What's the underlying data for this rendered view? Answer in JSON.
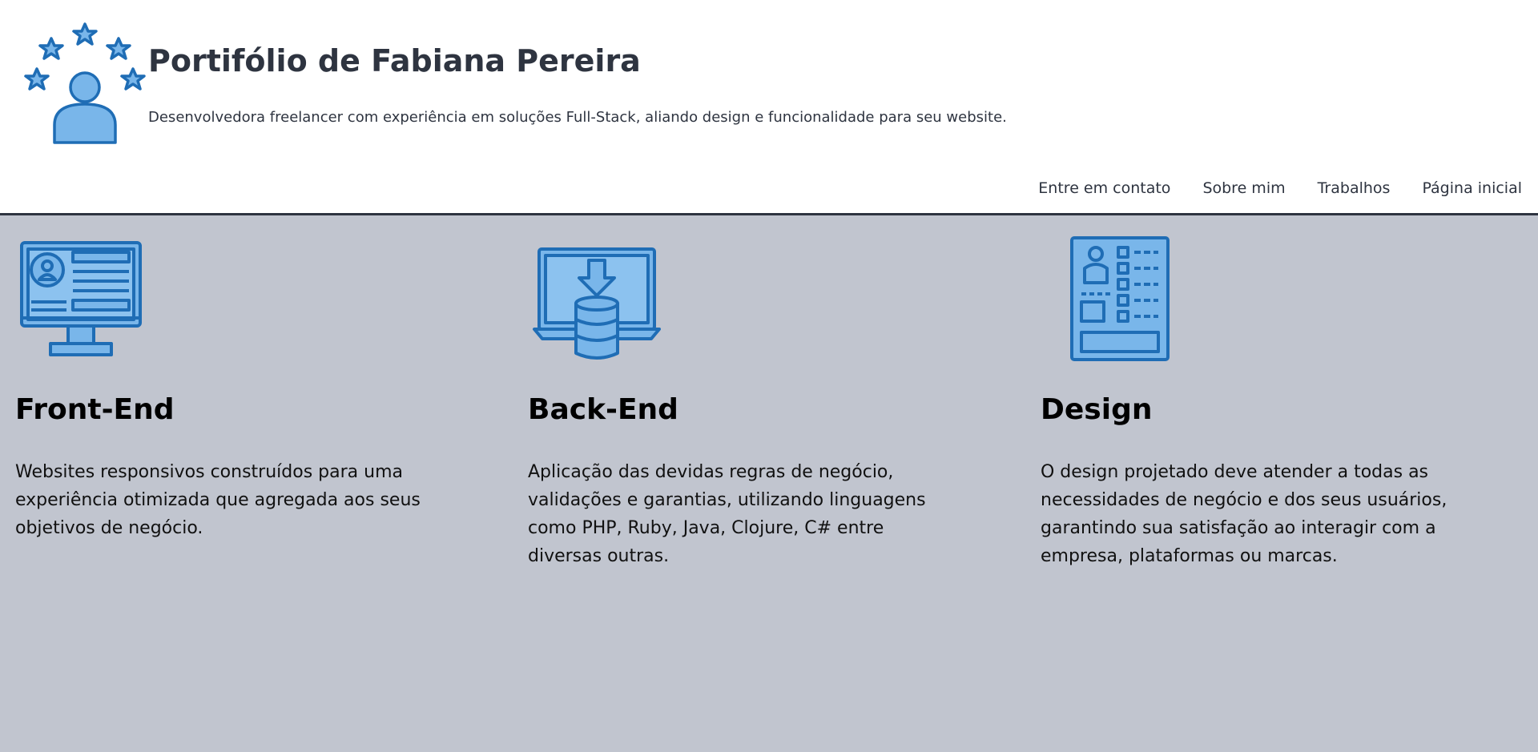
{
  "header": {
    "title": "Portifólio de Fabiana Pereira",
    "subtitle": "Desenvolvedora freelancer com experiência em soluções Full-Stack, aliando design e funcionalidade para seu website.",
    "logo_icon": "user-stars-icon"
  },
  "nav": {
    "items": [
      {
        "label": "Entre em contato"
      },
      {
        "label": "Sobre mim"
      },
      {
        "label": "Trabalhos"
      },
      {
        "label": "Página inicial"
      }
    ]
  },
  "services": [
    {
      "title": "Front-End",
      "description": "Websites responsivos construídos para uma experiência otimizada que agregada aos seus objetivos de negócio.",
      "icon": "monitor-profile-icon"
    },
    {
      "title": "Back-End",
      "description": "Aplicação das devidas regras de negócio, validações e garantias, utilizando linguagens como PHP, Ruby, Java, Clojure, C# entre diversas outras.",
      "icon": "laptop-database-icon"
    },
    {
      "title": "Design",
      "description": "O design projetado deve atender a todas as necessidades de negócio e dos seus usuários, garantindo sua satisfação ao interagir com a empresa, plataformas ou marcas.",
      "icon": "document-layout-icon"
    }
  ],
  "colors": {
    "header_bg": "#ffffff",
    "main_bg": "#c1c5cf",
    "text_dark": "#2e3440",
    "icon_fill": "#79b6ea",
    "icon_stroke": "#1f6db5"
  }
}
